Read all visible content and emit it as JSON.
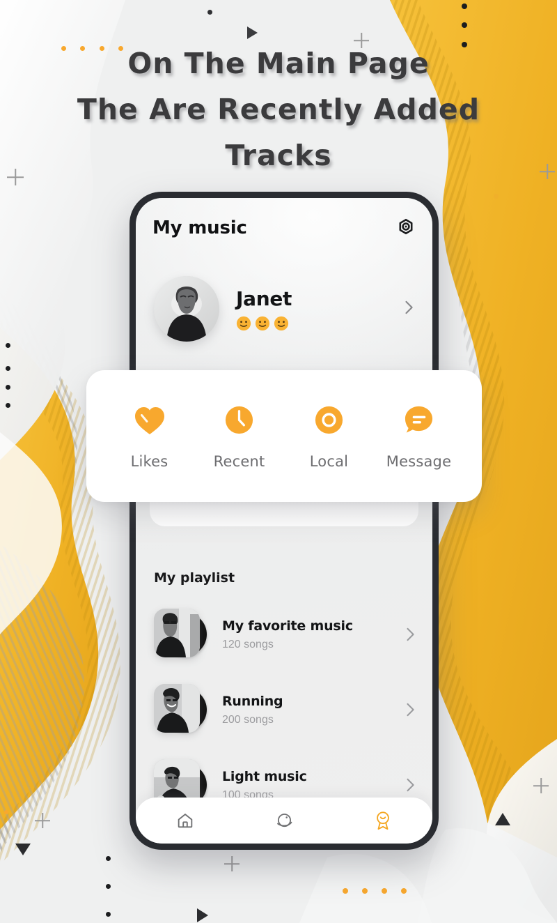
{
  "headline": {
    "line1": "On The Main Page",
    "line2": "The Are Recently Added",
    "line3": "Tracks"
  },
  "colors": {
    "accent_orange": "#F8A82E",
    "wave_yellow": "#EFB124",
    "background": "#EFF0F0",
    "phone_frame": "#2A2C31",
    "text_dark": "#131416",
    "text_muted": "#9C9C9F",
    "headline_gray": "#3B3B3D"
  },
  "app": {
    "title": "My music",
    "settings_icon": "gear-icon",
    "profile": {
      "name": "Janet",
      "avatar": "user-avatar",
      "badges": [
        "smiley-emoji",
        "smiley-emoji",
        "smiley-emoji"
      ],
      "chevron": "chevron-right-icon"
    },
    "quick_actions": [
      {
        "label": "Likes",
        "icon": "heart-icon"
      },
      {
        "label": "Recent",
        "icon": "clock-icon"
      },
      {
        "label": "Local",
        "icon": "disc-icon"
      },
      {
        "label": "Message",
        "icon": "chat-bubble-icon"
      }
    ],
    "playlist": {
      "section_title": "My playlist",
      "items": [
        {
          "name": "My favorite music",
          "count": "120 songs"
        },
        {
          "name": "Running",
          "count": "200 songs"
        },
        {
          "name": "Light music",
          "count": "100 songs"
        }
      ]
    },
    "bottom_nav": [
      {
        "icon": "home-icon",
        "active": false
      },
      {
        "icon": "planet-icon",
        "active": false
      },
      {
        "icon": "profile-badge-icon",
        "active": true
      }
    ]
  }
}
